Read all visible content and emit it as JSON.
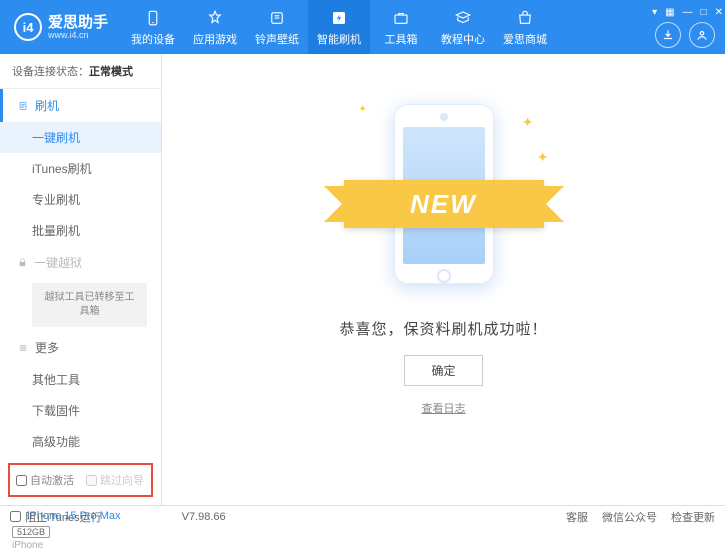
{
  "app": {
    "name": "爱思助手",
    "site": "www.i4.cn"
  },
  "nav": [
    {
      "label": "我的设备"
    },
    {
      "label": "应用游戏"
    },
    {
      "label": "铃声壁纸"
    },
    {
      "label": "智能刷机"
    },
    {
      "label": "工具箱"
    },
    {
      "label": "教程中心"
    },
    {
      "label": "爱思商城"
    }
  ],
  "sidebar": {
    "conn_label": "设备连接状态：",
    "conn_value": "正常模式",
    "sec_flash": "刷机",
    "items_flash": [
      "一键刷机",
      "iTunes刷机",
      "专业刷机",
      "批量刷机"
    ],
    "sec_jailbreak": "一键越狱",
    "jailbreak_note": "越狱工具已转移至工具箱",
    "sec_more": "更多",
    "items_more": [
      "其他工具",
      "下载固件",
      "高级功能"
    ],
    "chk_auto": "自动激活",
    "chk_skip": "跳过向导"
  },
  "device": {
    "name": "iPhone 15 Pro Max",
    "storage": "512GB",
    "type": "iPhone"
  },
  "main": {
    "ribbon": "NEW",
    "success": "恭喜您，保资料刷机成功啦！",
    "ok": "确定",
    "log": "查看日志"
  },
  "footer": {
    "block_itunes": "阻止iTunes运行",
    "version": "V7.98.66",
    "links": [
      "客服",
      "微信公众号",
      "检查更新"
    ]
  }
}
